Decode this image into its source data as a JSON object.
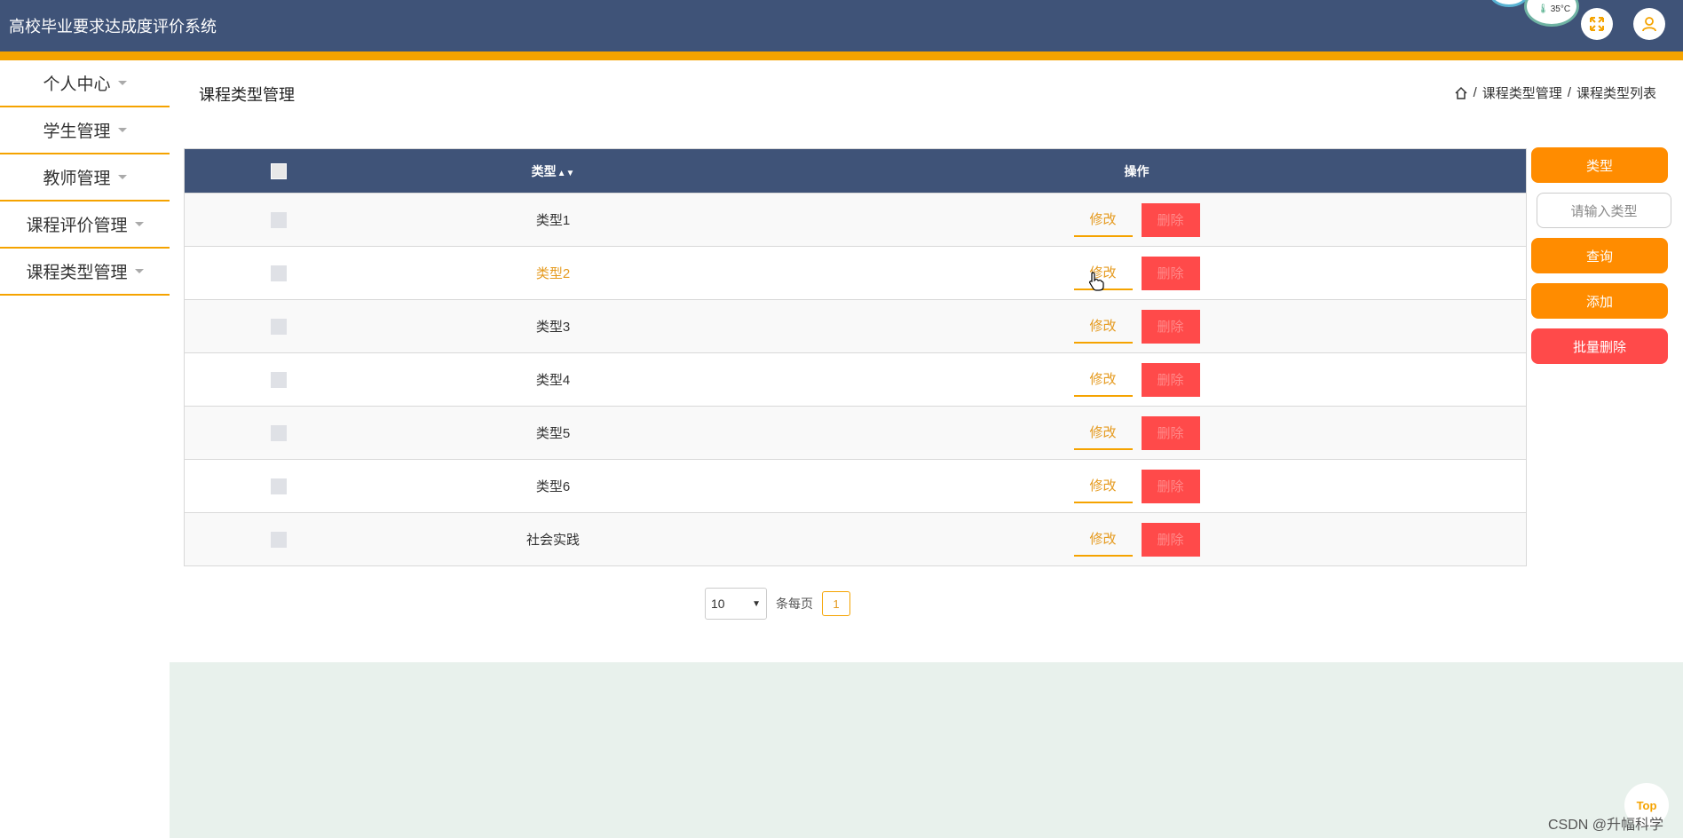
{
  "app": {
    "title": "高校毕业要求达成度评价系统"
  },
  "header": {
    "temperature": "35°C"
  },
  "sidebar": {
    "items": [
      {
        "label": "个人中心"
      },
      {
        "label": "学生管理"
      },
      {
        "label": "教师管理"
      },
      {
        "label": "课程评价管理"
      },
      {
        "label": "课程类型管理"
      }
    ]
  },
  "page": {
    "title": "课程类型管理",
    "breadcrumb": [
      "课程类型管理",
      "课程类型列表"
    ]
  },
  "table": {
    "columns": {
      "type": "类型",
      "operation": "操作"
    },
    "rows": [
      {
        "type": "类型1",
        "edit": "修改",
        "delete": "删除"
      },
      {
        "type": "类型2",
        "edit": "修改",
        "delete": "删除"
      },
      {
        "type": "类型3",
        "edit": "修改",
        "delete": "删除"
      },
      {
        "type": "类型4",
        "edit": "修改",
        "delete": "删除"
      },
      {
        "type": "类型5",
        "edit": "修改",
        "delete": "删除"
      },
      {
        "type": "类型6",
        "edit": "修改",
        "delete": "删除"
      },
      {
        "type": "社会实践",
        "edit": "修改",
        "delete": "删除"
      }
    ]
  },
  "pagination": {
    "page_size": "10",
    "per_page_label": "条每页",
    "current_page": "1"
  },
  "right_panel": {
    "type_label": "类型",
    "search_placeholder": "请输入类型",
    "query_label": "查询",
    "add_label": "添加",
    "batch_delete_label": "批量删除"
  },
  "footer": {
    "top_label": "Top",
    "watermark": "CSDN @升幅科学"
  },
  "colors": {
    "header_bg": "#3f5378",
    "accent": "#f5a300",
    "orange_button": "#ff8c00",
    "delete_red": "#ff4a4a"
  }
}
